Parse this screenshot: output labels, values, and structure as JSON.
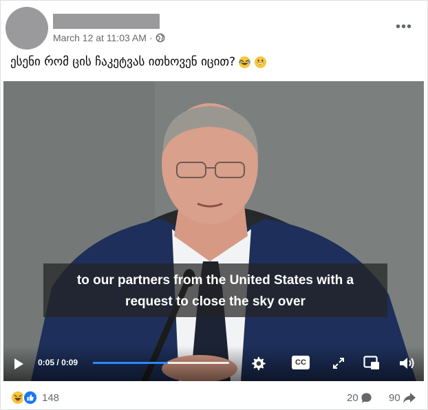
{
  "post": {
    "timestamp": "March 12 at 11:03 AM",
    "separator": "·",
    "privacy_icon": "globe-icon",
    "more_label": "•••",
    "caption_text": "ესენი რომ ცის ჩაკეტვას ითხოვენ იცით?",
    "caption_emojis": [
      "rolling-laughing-emoji",
      "grinning-emoji"
    ]
  },
  "video": {
    "subtitle_line1": "to our partners from the United States with a",
    "subtitle_line2": "request to close the sky over",
    "current_time": "0:05",
    "time_separator": "/",
    "duration": "0:09",
    "progress_fraction": 0.55,
    "buffer_fraction": 1.0,
    "cc_label": "CC",
    "accent_color": "#2d88ff"
  },
  "footer": {
    "reaction_icons": [
      "haha-reaction-icon",
      "like-reaction-icon"
    ],
    "reaction_count": "148",
    "comment_count": "20",
    "share_count": "90"
  }
}
